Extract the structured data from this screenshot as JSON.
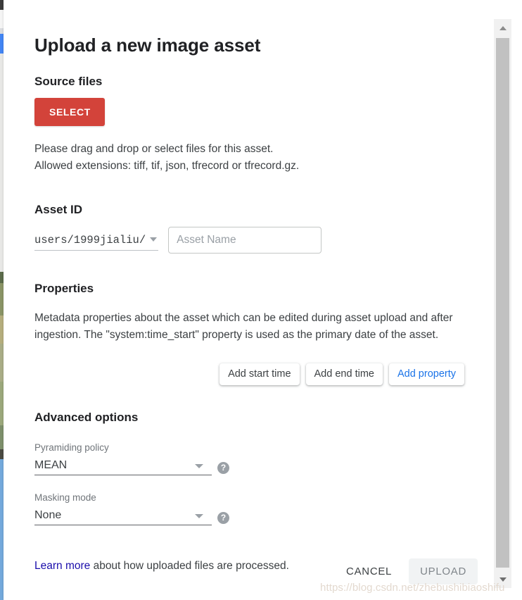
{
  "dialog": {
    "title": "Upload a new image asset"
  },
  "source_files": {
    "heading": "Source files",
    "select_label": "SELECT",
    "note_line1": "Please drag and drop or select files for this asset.",
    "note_line2": "Allowed extensions: tiff, tif, json, tfrecord or tfrecord.gz."
  },
  "asset_id": {
    "heading": "Asset ID",
    "prefix": "users/1999jialiu/",
    "name_value": "",
    "name_placeholder": "Asset Name"
  },
  "properties": {
    "heading": "Properties",
    "description": "Metadata properties about the asset which can be edited during asset upload and after ingestion. The \"system:time_start\" property is used as the primary date of the asset.",
    "buttons": [
      {
        "label": "Add start time",
        "style": "default"
      },
      {
        "label": "Add end time",
        "style": "default"
      },
      {
        "label": "Add property",
        "style": "link"
      }
    ]
  },
  "advanced_options": {
    "heading": "Advanced options",
    "fields": [
      {
        "label": "Pyramiding policy",
        "value": "MEAN",
        "help": "?"
      },
      {
        "label": "Masking mode",
        "value": "None",
        "help": "?"
      }
    ]
  },
  "learn_more": {
    "link_text": "Learn more",
    "rest_text": " about how uploaded files are processed."
  },
  "actions": {
    "cancel_label": "CANCEL",
    "upload_label": "UPLOAD"
  },
  "watermark": {
    "text": "https://blog.csdn.net/zhebushibiaoshifu"
  },
  "colors": {
    "select_button": "#d3433a",
    "link_blue": "#1a73e8",
    "learn_more_blue": "#1a0dab",
    "scrollbar_thumb": "#c1c1c1"
  }
}
